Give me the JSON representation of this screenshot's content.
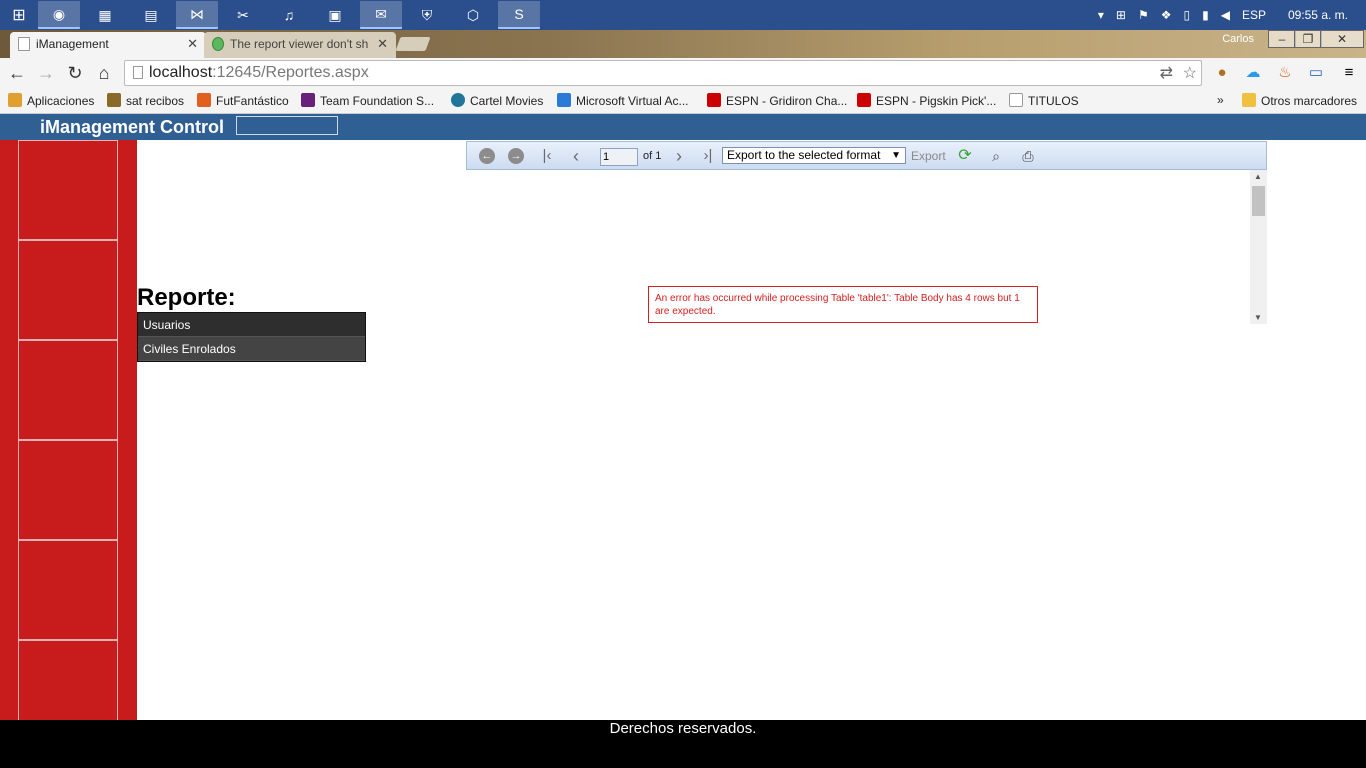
{
  "taskbar": {
    "apps": [
      {
        "name": "windows-start-icon",
        "glyph": "⊞"
      },
      {
        "name": "chrome-app-icon",
        "glyph": "◉",
        "active": true
      },
      {
        "name": "excel-app-icon",
        "glyph": "▦"
      },
      {
        "name": "file-explorer-app-icon",
        "glyph": "▤"
      },
      {
        "name": "visual-studio-app-icon",
        "glyph": "⋈",
        "active": true
      },
      {
        "name": "tools-app-icon",
        "glyph": "✂"
      },
      {
        "name": "itunes-app-icon",
        "glyph": "♫"
      },
      {
        "name": "remote-app-icon",
        "glyph": "▣"
      },
      {
        "name": "outlook-app-icon",
        "glyph": "✉",
        "active": true
      },
      {
        "name": "shield-app-icon",
        "glyph": "⛨"
      },
      {
        "name": "hexagon-app-icon",
        "glyph": "⬡"
      },
      {
        "name": "skype-app-icon",
        "glyph": "S",
        "active": true
      }
    ],
    "lang": "ESP",
    "clock": "09:55 a. m."
  },
  "browser": {
    "tabs": [
      {
        "title": "iManagement"
      },
      {
        "title": "The report viewer don't sh"
      }
    ],
    "user": "Carlos",
    "url_host": "localhost",
    "url_path": ":12645/Reportes.aspx"
  },
  "bookmarks": [
    {
      "label": "Aplicaciones",
      "color": "#e0a030"
    },
    {
      "label": "sat recibos",
      "color": "#8a6a2a"
    },
    {
      "label": "FutFantástico",
      "color": "#e06020"
    },
    {
      "label": "Team Foundation S...",
      "color": "#68217a"
    },
    {
      "label": "Cartel Movies",
      "color": "#21759b"
    },
    {
      "label": "Microsoft Virtual Ac...",
      "color": "#2a7ad6"
    },
    {
      "label": "ESPN - Gridiron Cha...",
      "color": "#cc0000"
    },
    {
      "label": "ESPN - Pigskin Pick'...",
      "color": "#cc0000"
    },
    {
      "label": "TITULOS",
      "color": "#ffffff"
    }
  ],
  "bookmarks_more": "»",
  "bookmarks_other": "Otros marcadores",
  "site": {
    "title": "iManagement Control",
    "report_label": "Reporte:",
    "reports": [
      "Usuarios",
      "Civiles Enrolados"
    ],
    "footer": "Derechos reservados."
  },
  "report_viewer": {
    "page": "1",
    "of": "of 1",
    "export_format": "Export to the selected format",
    "export_label": "Export",
    "error": "An error has occurred while processing Table 'table1': Table Body has 4 rows but 1 are expected."
  },
  "colors": {
    "sidebar": "#c81b1b",
    "header": "#2f5f93",
    "error": "#d42020"
  }
}
